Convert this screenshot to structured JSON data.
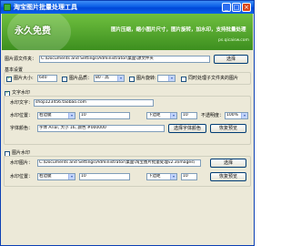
{
  "window": {
    "title": "淘宝图片批量处理工具",
    "minimize": "_",
    "maximize": "□",
    "close": "×"
  },
  "banner": {
    "free_text": "永久免费",
    "slogan": "图片压缩，缩小图片尺寸，图片旋转，加水印，支持批量处理",
    "site": "ps.qicaisw.com"
  },
  "folder": {
    "label": "图片源文件夹：",
    "value": "C:\\Documents and Settings\\Administrator\\桌面\\源文件夹",
    "button": "选择"
  },
  "basic": {
    "title": "基本设置",
    "width_label": "图片大小:",
    "width_value": "640",
    "quality_label": "图片品质：",
    "quality_value": "80 - 高",
    "rotate_label": "图片旋转:",
    "rotate_value": "",
    "overwrite_label": "同时处理子文件夹的图片"
  },
  "text_wm": {
    "title": "文字水印",
    "content_label": "水印文字：",
    "content_value": "shop123456.taobao.com",
    "position_label": "水印位置：",
    "position_value": "右边腿",
    "offset_value": "10",
    "align_value": "下边距",
    "align_offset": "10",
    "opacity_label": "不透明度：",
    "opacity_value": "100%",
    "font_label": "字体颜色：",
    "font_value": "字体 Arial, 大小 16, 颜色 #000000",
    "font_button": "选择字体颜色",
    "reset_button": "恢复预览"
  },
  "image_wm": {
    "title": "图片水印",
    "file_label": "水印图片：",
    "file_value": "C:\\Documents and Settings\\Administrator\\桌面\\淘宝图片批量处理v2.3\\images\\",
    "file_button": "选择",
    "position_label": "水印位置：",
    "position_value": "右边腿",
    "offset_value": "10",
    "align_value": "下边距",
    "align_offset": "10",
    "reset_button": "恢复预览"
  }
}
